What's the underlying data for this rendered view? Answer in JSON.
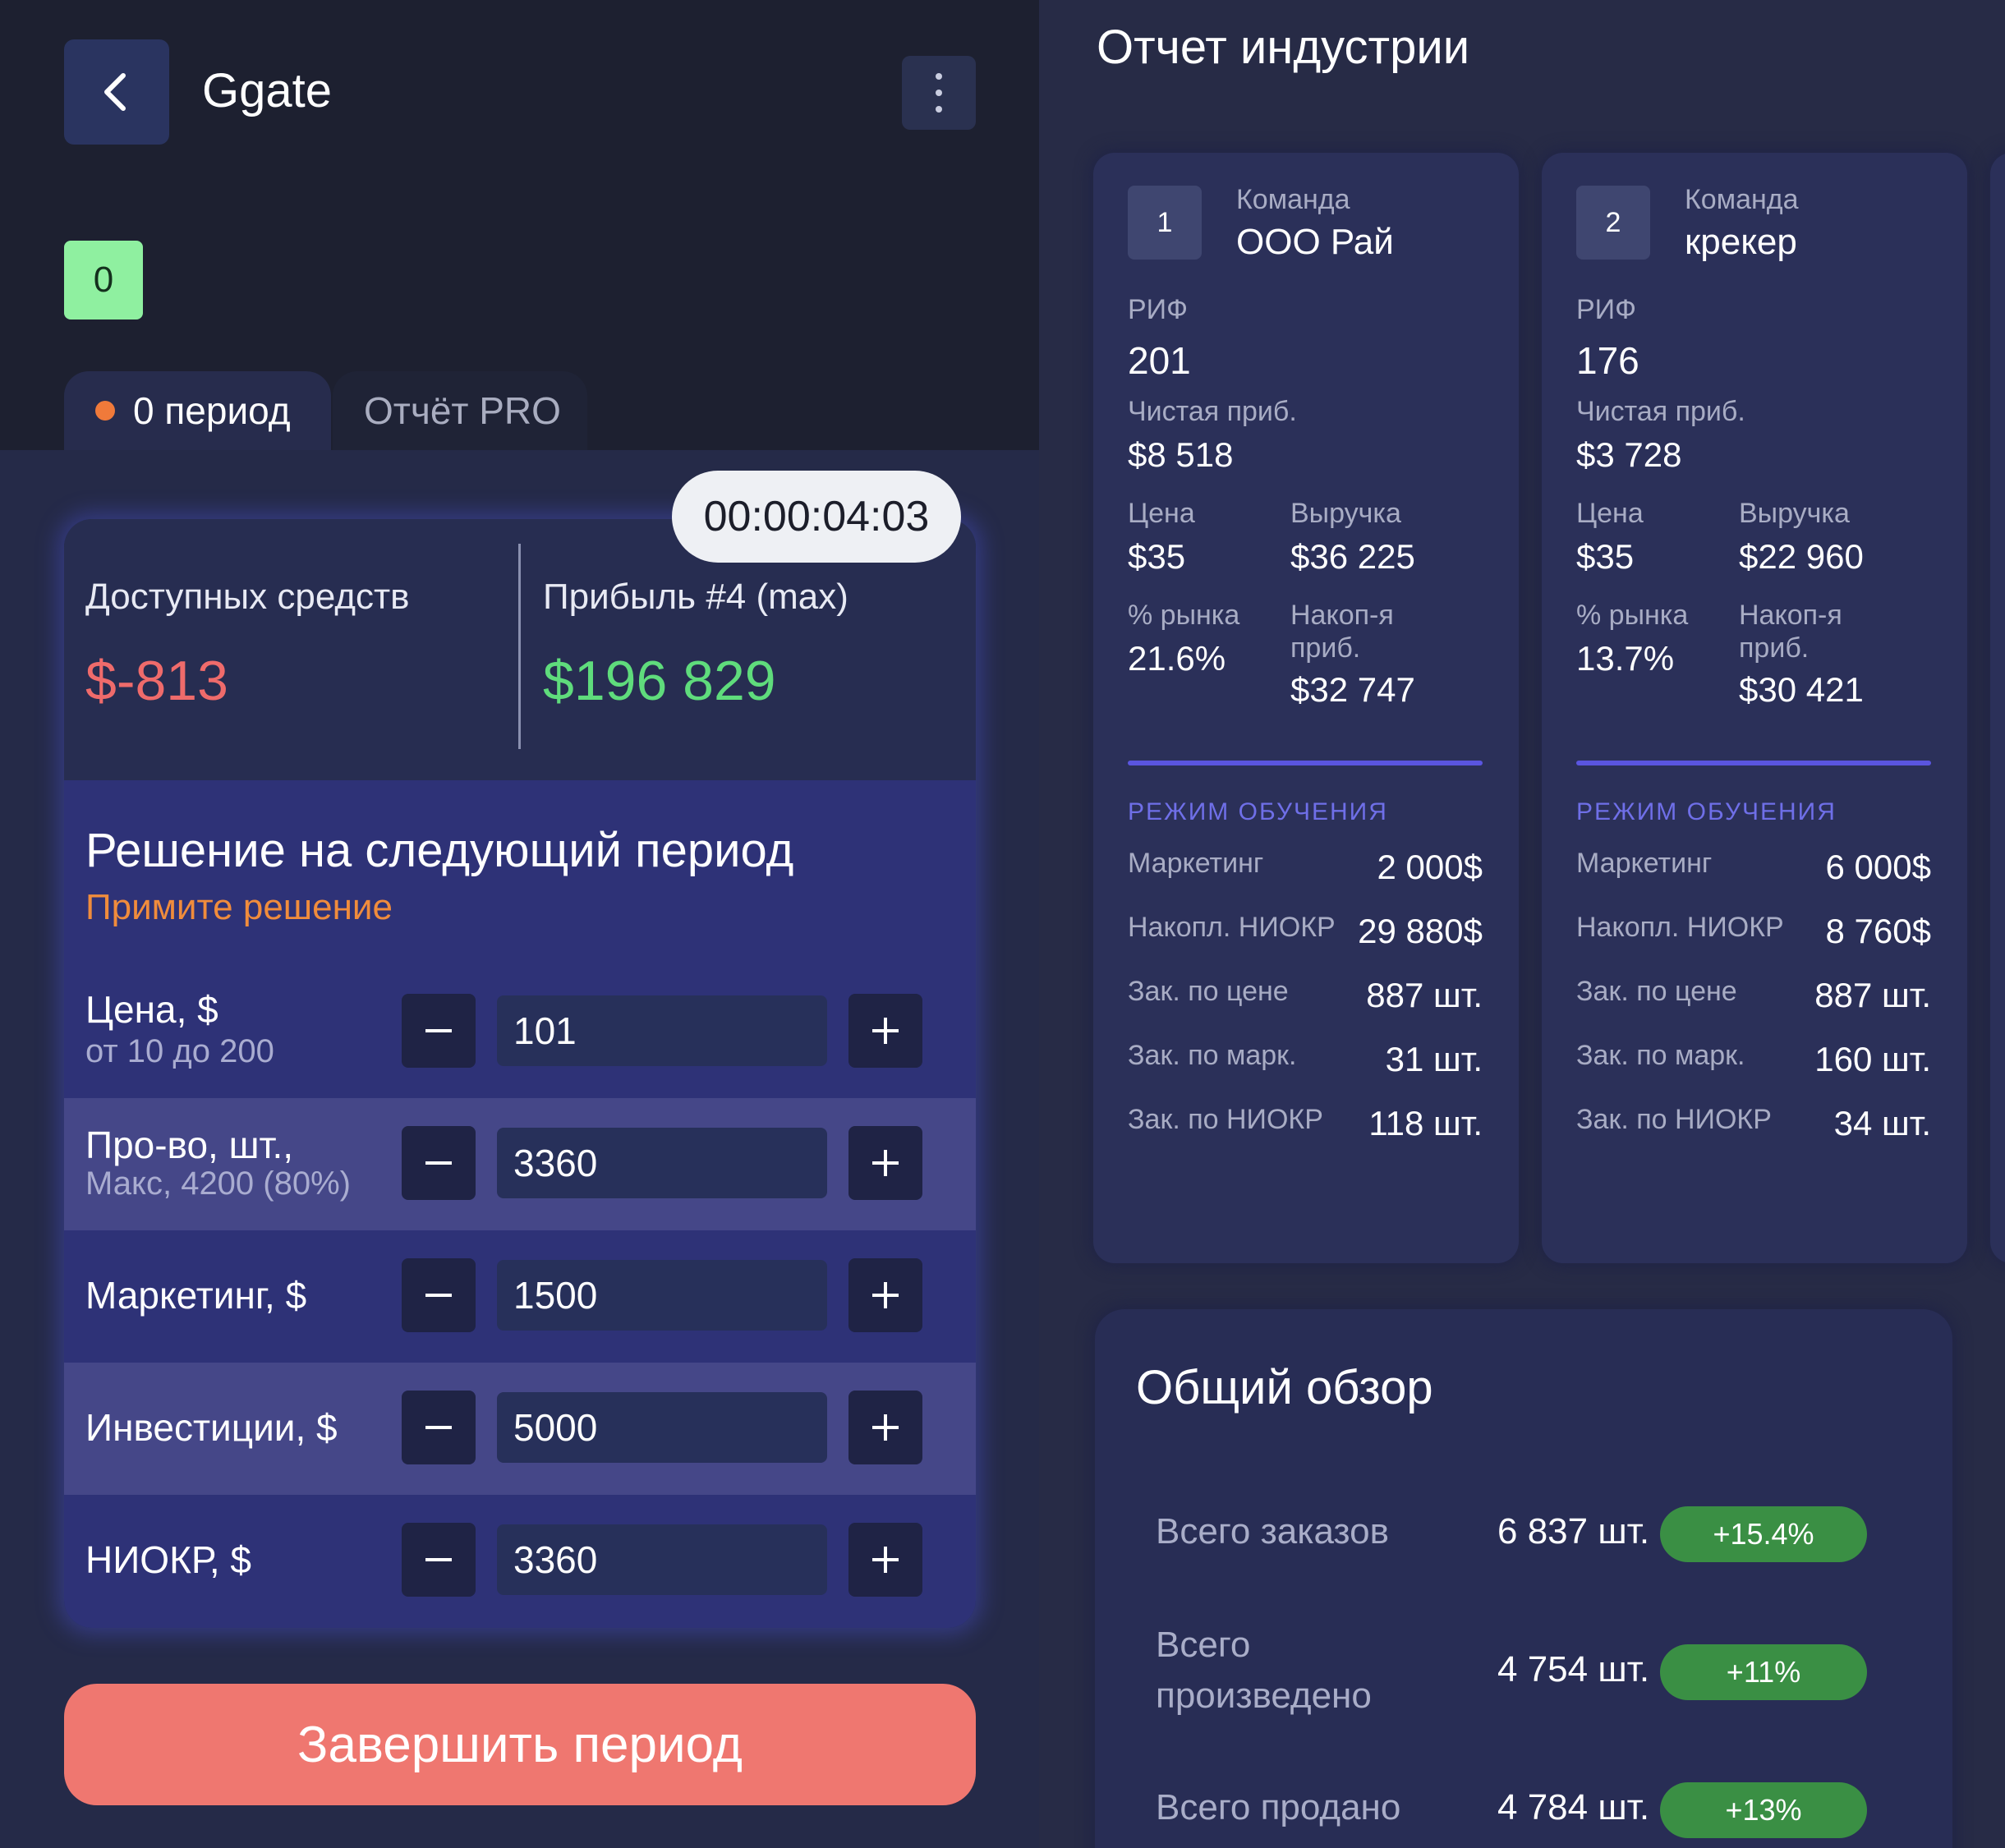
{
  "header": {
    "app_title": "Ggate",
    "badge": "0"
  },
  "tabs": {
    "period": "0 период",
    "report": "Отчёт PRO"
  },
  "timer": "00:00:04:03",
  "funds": {
    "available_label": "Доступных средств",
    "available_value": "$-813",
    "profit_label": "Прибыль #4 (max)",
    "profit_value": "$196 829"
  },
  "decision": {
    "title": "Решение на следующий период",
    "subtitle": "Примите решение",
    "rows": [
      {
        "label": "Цена, $",
        "sub": "от 10 до 200",
        "value": "101"
      },
      {
        "label": "Про-во, шт.,",
        "sub": "Макс, 4200 (80%)",
        "value": "3360"
      },
      {
        "label": "Маркетинг, $",
        "sub": "",
        "value": "1500"
      },
      {
        "label": "Инвестиции, $",
        "sub": "",
        "value": "5000"
      },
      {
        "label": "НИОКР, $",
        "sub": "",
        "value": "3360"
      }
    ],
    "minus": "−",
    "plus": "+"
  },
  "finish_button": "Завершить период",
  "industry": {
    "title": "Отчет индустрии",
    "labels": {
      "team": "Команда",
      "rif": "РИФ",
      "net_profit": "Чистая приб.",
      "price": "Цена",
      "revenue": "Выручка",
      "market_share": "% рынка",
      "accum_profit_1": "Накоп-я",
      "accum_profit_2": "приб.",
      "mode": "РЕЖИМ ОБУЧЕНИЯ",
      "marketing": "Маркетинг",
      "accum_rnd": "Накопл. НИОКР",
      "orders_price": "Зак. по цене",
      "orders_marketing": "Зак. по марк.",
      "orders_rnd": "Зак. по НИОКР"
    },
    "teams": [
      {
        "rank": "1",
        "name": "ООО Рай",
        "rif": "201",
        "net_profit": "$8 518",
        "price": "$35",
        "revenue": "$36 225",
        "market_share": "21.6%",
        "accum_profit": "$32 747",
        "marketing": "2 000$",
        "accum_rnd": "29 880$",
        "orders_price": "887 шт.",
        "orders_marketing": "31 шт.",
        "orders_rnd": "118 шт."
      },
      {
        "rank": "2",
        "name": "крекер",
        "rif": "176",
        "net_profit": "$3 728",
        "price": "$35",
        "revenue": "$22 960",
        "market_share": "13.7%",
        "accum_profit": "$30 421",
        "marketing": "6 000$",
        "accum_rnd": "8 760$",
        "orders_price": "887 шт.",
        "orders_marketing": "160 шт.",
        "orders_rnd": "34 шт."
      }
    ]
  },
  "overview": {
    "title": "Общий обзор",
    "rows": [
      {
        "label": "Всего заказов",
        "value": "6 837 шт.",
        "change": "+15.4%"
      },
      {
        "label": "Всего произведено",
        "value": "4 754 шт.",
        "change": "+11%"
      },
      {
        "label": "Всего продано",
        "value": "4 784 шт.",
        "change": "+13%"
      }
    ]
  },
  "colors": {
    "negative": "#ef6b6b",
    "positive": "#5fdc7c",
    "accent_orange": "#f08c3c",
    "finish_button": "#ef7770",
    "badge_green": "#3a8f44"
  },
  "icons": {
    "back": "chevron-left-icon",
    "more": "more-vertical-icon",
    "minus": "minus-icon",
    "plus": "plus-icon"
  }
}
